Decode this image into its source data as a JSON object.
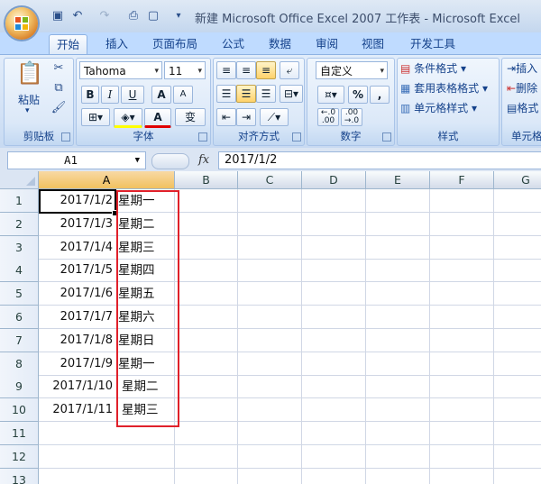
{
  "window": {
    "title": "新建 Microsoft Office Excel 2007 工作表 - Microsoft Excel"
  },
  "quick_access": [
    "save-icon",
    "undo-icon",
    "redo-icon",
    "print-preview-icon",
    "new-icon",
    "customize-icon"
  ],
  "tabs": [
    {
      "label": "开始",
      "active": true
    },
    {
      "label": "插入"
    },
    {
      "label": "页面布局"
    },
    {
      "label": "公式"
    },
    {
      "label": "数据"
    },
    {
      "label": "审阅"
    },
    {
      "label": "视图"
    },
    {
      "label": "开发工具"
    }
  ],
  "ribbon": {
    "clipboard": {
      "label": "剪贴板",
      "paste": "粘贴"
    },
    "font": {
      "label": "字体",
      "font_name": "Tahoma",
      "font_size": "11",
      "bold": "B",
      "italic": "I",
      "underline": "U",
      "grow": "A",
      "shrink": "A",
      "color_a": "A",
      "phonetic": "变"
    },
    "alignment": {
      "label": "对齐方式"
    },
    "number": {
      "label": "数字",
      "format": "自定义",
      "percent": "%"
    },
    "styles": {
      "label": "样式",
      "conditional": "条件格式",
      "table": "套用表格格式",
      "cell_styles": "单元格样式"
    },
    "cells": {
      "label": "单元格",
      "insert": "插入",
      "delete": "删除",
      "format": "格式"
    }
  },
  "formula_bar": {
    "name_box": "A1",
    "fx": "fx",
    "formula": "2017/1/2"
  },
  "columns": [
    "A",
    "B",
    "C",
    "D",
    "E",
    "F",
    "G"
  ],
  "row_numbers": [
    "1",
    "2",
    "3",
    "4",
    "5",
    "6",
    "7",
    "8",
    "9",
    "10",
    "11",
    "12",
    "13"
  ],
  "rows": [
    {
      "a": "2017/1/2",
      "b": "星期一"
    },
    {
      "a": "2017/1/3",
      "b": "星期二"
    },
    {
      "a": "2017/1/4",
      "b": "星期三"
    },
    {
      "a": "2017/1/5",
      "b": "星期四"
    },
    {
      "a": "2017/1/6",
      "b": "星期五"
    },
    {
      "a": "2017/1/7",
      "b": "星期六"
    },
    {
      "a": "2017/1/8",
      "b": "星期日"
    },
    {
      "a": "2017/1/9",
      "b": "星期一"
    },
    {
      "a": "2017/1/10",
      "b": "星期二"
    },
    {
      "a": "2017/1/11",
      "b": "星期三"
    }
  ],
  "colors": {
    "highlight": "#e0202a",
    "selected_header": "#f1c15f",
    "ribbon_text": "#15428b"
  }
}
